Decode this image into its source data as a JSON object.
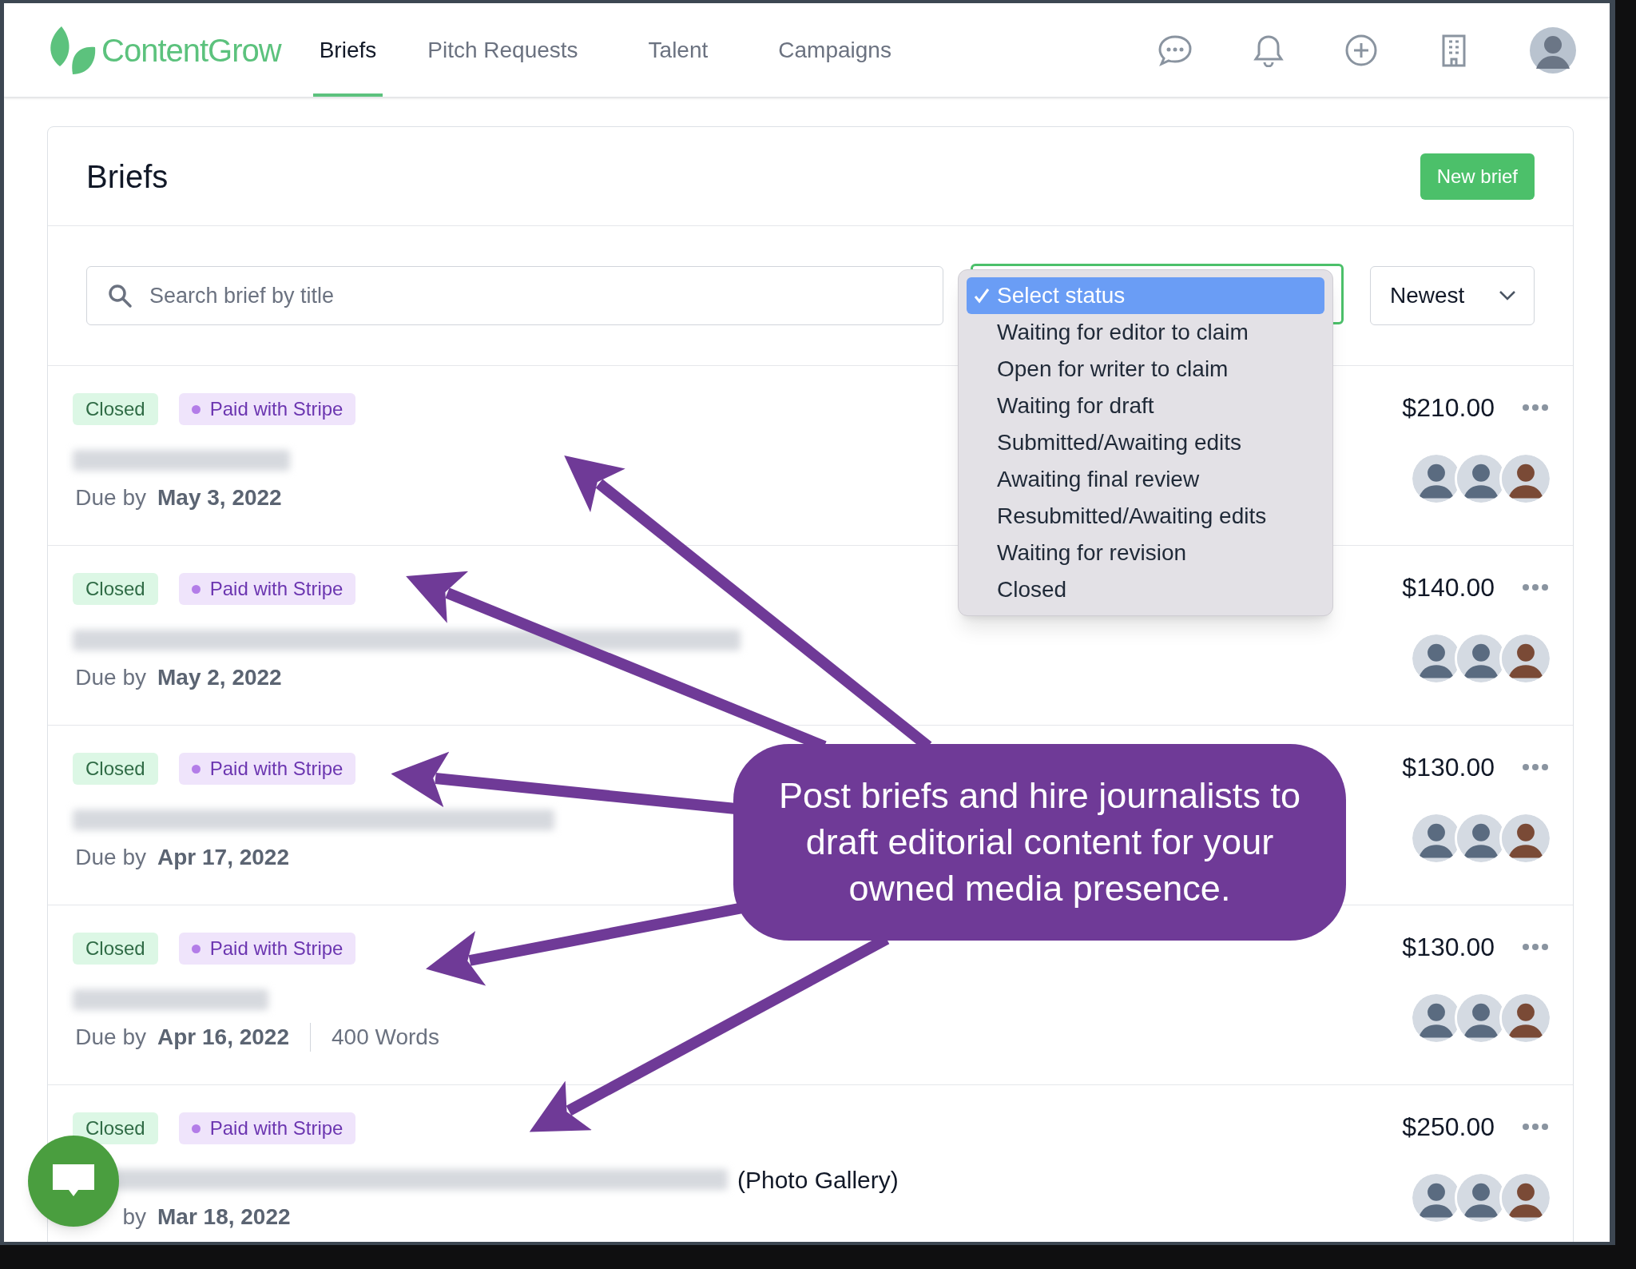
{
  "header": {
    "brand": "ContentGrow",
    "tabs": [
      {
        "label": "Briefs",
        "selected": true
      },
      {
        "label": "Pitch Requests",
        "selected": false
      },
      {
        "label": "Talent",
        "selected": false
      },
      {
        "label": "Campaigns",
        "selected": false
      }
    ]
  },
  "page": {
    "title": "Briefs",
    "new_button": "New brief"
  },
  "filters": {
    "search": {
      "placeholder": "Search brief by title"
    },
    "sort": "Newest",
    "status_menu": [
      {
        "label": "Select status",
        "selected": true
      },
      {
        "label": "Waiting for editor to claim",
        "selected": false
      },
      {
        "label": "Open for writer to claim",
        "selected": false
      },
      {
        "label": "Waiting for draft",
        "selected": false
      },
      {
        "label": "Submitted/Awaiting edits",
        "selected": false
      },
      {
        "label": "Awaiting final review",
        "selected": false
      },
      {
        "label": "Resubmitted/Awaiting edits",
        "selected": false
      },
      {
        "label": "Waiting for revision",
        "selected": false
      },
      {
        "label": "Closed",
        "selected": false
      }
    ]
  },
  "briefs": [
    {
      "status": "Closed",
      "payment": "Paid with Stripe",
      "due_label": "Due by",
      "due_date": "May 3, 2022",
      "price": "$210.00"
    },
    {
      "status": "Closed",
      "payment": "Paid with Stripe",
      "due_label": "Due by",
      "due_date": "May 2, 2022",
      "price": "$140.00"
    },
    {
      "status": "Closed",
      "payment": "Paid with Stripe",
      "due_label": "Due by",
      "due_date": "Apr 17, 2022",
      "price": "$130.00"
    },
    {
      "status": "Closed",
      "payment": "Paid with Stripe",
      "due_label": "Due by",
      "due_date": "Apr 16, 2022",
      "words": "400 Words",
      "price": "$130.00"
    },
    {
      "status": "Closed",
      "payment": "Paid with Stripe",
      "title_suffix": "(Photo Gallery)",
      "due_label": "by",
      "due_date": "Mar 18, 2022",
      "price": "$250.00"
    }
  ],
  "callout": "Post briefs and hire journalists to draft editorial content for your owned media presence."
}
